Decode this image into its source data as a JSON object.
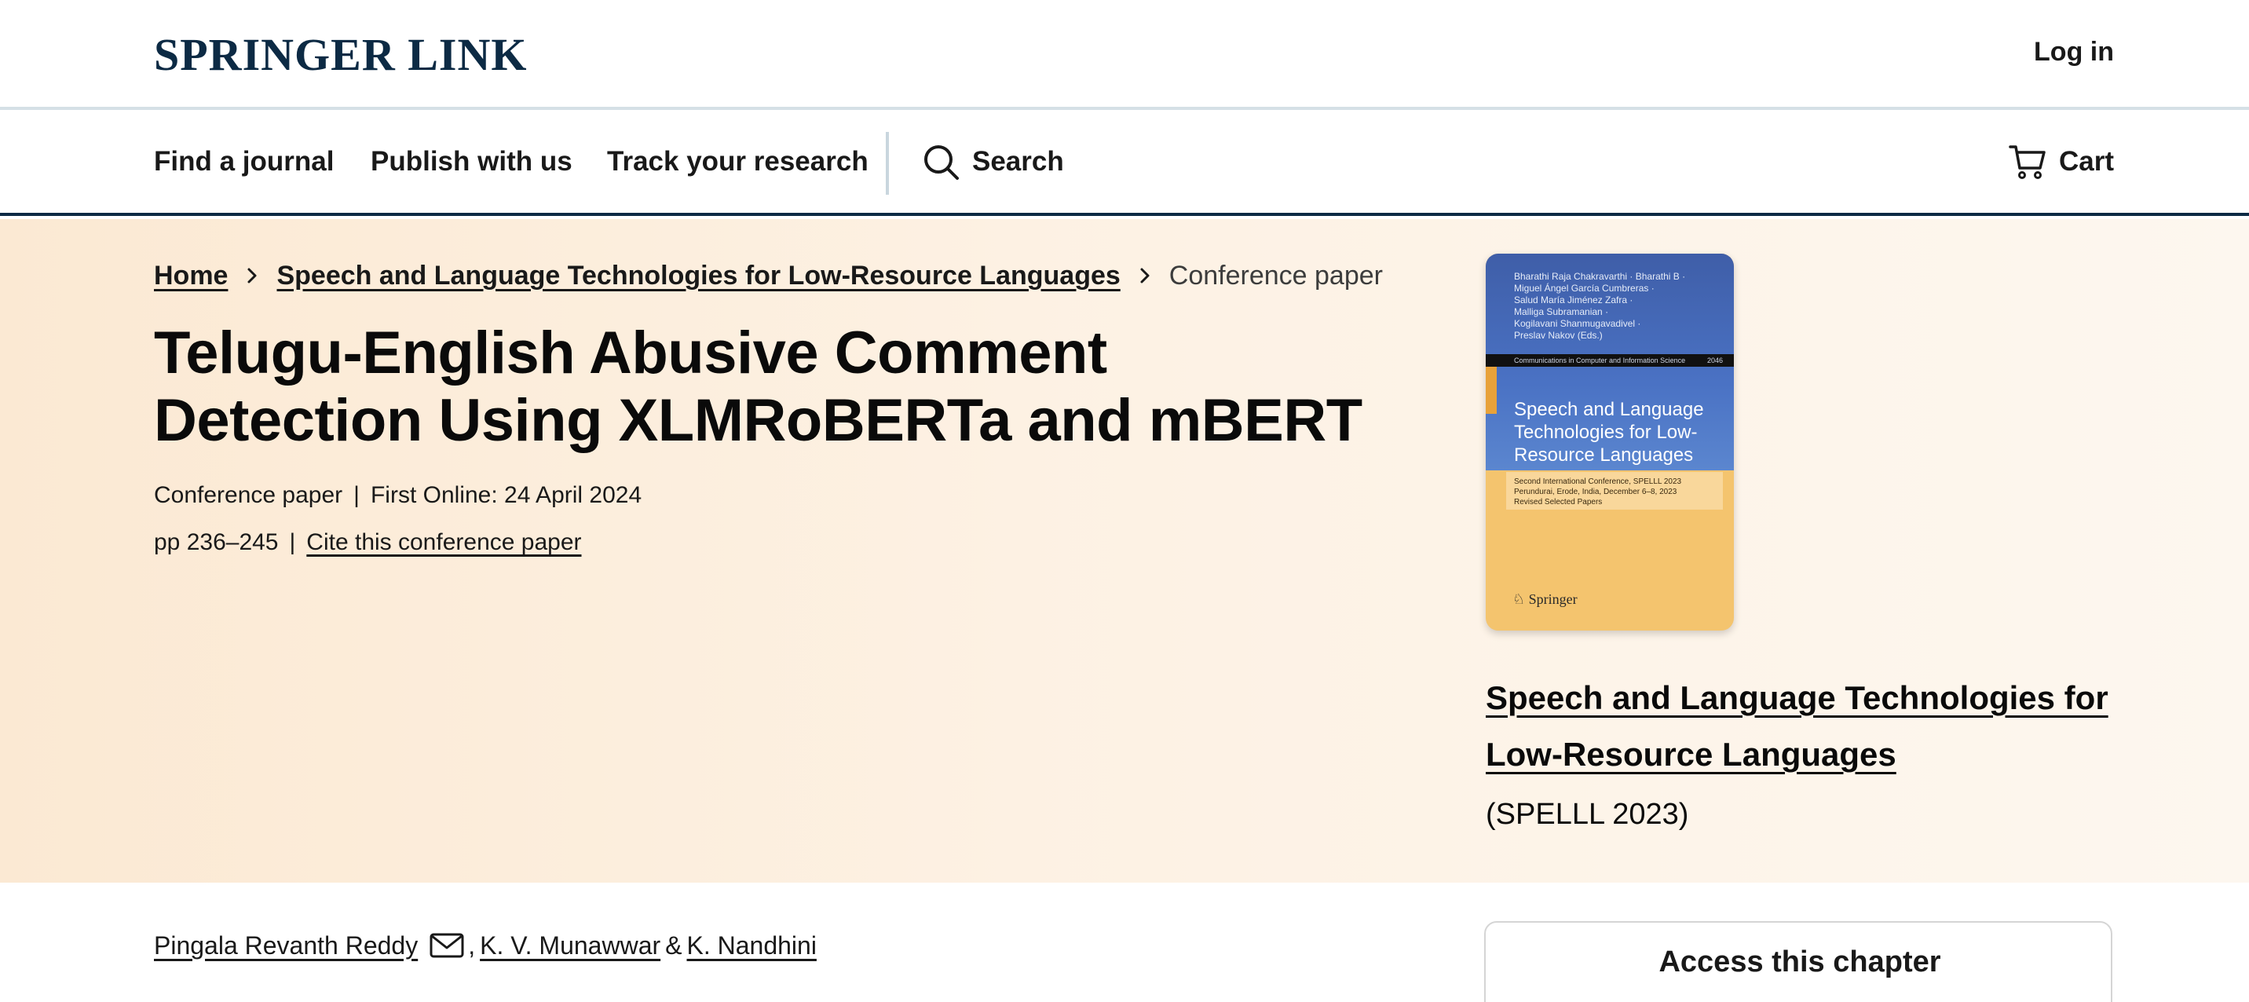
{
  "header": {
    "logo": "SPRINGER LINK",
    "login": "Log in"
  },
  "nav": {
    "items": [
      "Find a journal",
      "Publish with us",
      "Track your research"
    ],
    "search": "Search",
    "cart": "Cart"
  },
  "breadcrumb": {
    "home": "Home",
    "book": "Speech and Language Technologies for Low-Resource Languages",
    "current": "Conference paper"
  },
  "article": {
    "title_line1": "Telugu-English Abusive Comment",
    "title_line2": "Detection Using XLMRoBERTa and mBERT",
    "type": "Conference paper",
    "first_online": "First Online: 24 April 2024",
    "pages": "pp 236–245",
    "cite": "Cite this conference paper"
  },
  "book_cover": {
    "editors": [
      "Bharathi Raja Chakravarthi · Bharathi B ·",
      "Miguel Ángel García Cumbreras ·",
      "Salud María Jiménez Zafra ·",
      "Malliga Subramanian ·",
      "Kogilavani Shanmugavadivel ·",
      "Preslav Nakov (Eds.)"
    ],
    "series": "Communications in Computer and Information Science",
    "series_number": "2046",
    "title": "Speech and Language Technologies for Low-Resource Languages",
    "subtitle_lines": [
      "Second International Conference, SPELLL 2023",
      "Perundurai, Erode, India, December 6–8, 2023",
      "Revised Selected Papers"
    ],
    "publisher": "Springer"
  },
  "book": {
    "link": "Speech and Language Technologies for Low-Resource Languages",
    "conference": "(SPELLL 2023)"
  },
  "authors": {
    "list": [
      "Pingala Revanth Reddy",
      "K. V. Munawwar",
      "K. Nandhini"
    ],
    "comma": ",",
    "amp": "&"
  },
  "access": {
    "title": "Access this chapter"
  },
  "colors": {
    "brand_navy": "#0c2a44",
    "hero_bg": "#fbe9d3",
    "cover_blue": "#4a72c4",
    "cover_orange": "#f4c46e"
  },
  "icons": [
    "search-icon",
    "cart-icon",
    "chevron-right-icon",
    "mail-icon",
    "springer-horse-icon"
  ]
}
